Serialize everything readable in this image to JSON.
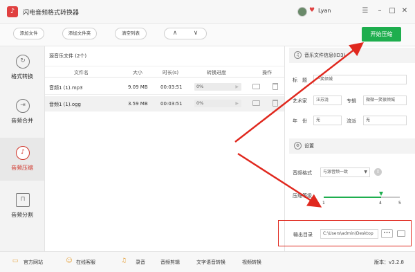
{
  "window": {
    "title": "闪电音频格式转换器",
    "username": "Lyan",
    "minimize_label": "–",
    "maximize_label": "□",
    "close_label": "✕",
    "menu_label": "☰"
  },
  "toolbar": {
    "add_file": "添加文件",
    "add_folder": "添加文件夹",
    "clear_list": "清空列表",
    "up_arrow": "∧",
    "down_arrow": "∨",
    "start_button": "开始压缩"
  },
  "sidebar": {
    "items": [
      {
        "label": "格式转换",
        "icon": "↻",
        "active": false
      },
      {
        "label": "音频合并",
        "icon": "⇥",
        "active": false
      },
      {
        "label": "音频压缩",
        "icon": "♪",
        "active": true
      },
      {
        "label": "音频分割",
        "icon": "⊓",
        "active": false
      }
    ]
  },
  "file_list": {
    "title": "源音乐文件 (2个)",
    "columns": [
      "文件名",
      "大小",
      "时长(s)",
      "转换进度",
      "操作"
    ],
    "rows": [
      {
        "name": "音频1 (1).mp3",
        "size": "9.09 MB",
        "duration": "00:03:51",
        "progress_text": "0%",
        "progress": 0
      },
      {
        "name": "音频1 (1).ogg",
        "size": "3.59 MB",
        "duration": "00:03:51",
        "progress_text": "0%",
        "progress": 0
      }
    ]
  },
  "music_info": {
    "section_title": "音乐文件信息(ID3)",
    "title_label": "标　题",
    "title_value": "一笑倾城",
    "artist_label": "艺术家",
    "artist_value": "汪苏泷",
    "album_label": "专辑",
    "album_value": "微微一笑很倾城",
    "year_label": "年　份",
    "year_value": "无",
    "genre_label": "流派",
    "genre_value": "无"
  },
  "settings": {
    "section_title": "设置",
    "format_label": "音频格式",
    "format_value": "与源音频一致",
    "compress_label": "压缩等级",
    "compress_level": 4,
    "compress_min": 1,
    "compress_max": 5,
    "tick_min": "1",
    "tick_value": "4",
    "tick_max": "5",
    "output_label": "输出目录",
    "output_value": "C:\\Users\\admin\\Desktop",
    "browse_label": "•••"
  },
  "bottom_bar": {
    "website": "官方网站",
    "support": "在线客服",
    "record": "录音",
    "audio_edit": "音频剪辑",
    "tts": "文字语音转换",
    "video_convert": "视频转换",
    "version": "版本：v3.2.8"
  },
  "colors": {
    "accent_green": "#1eae4e",
    "active_red": "#d0352a",
    "annotation_red": "#e0281e"
  }
}
